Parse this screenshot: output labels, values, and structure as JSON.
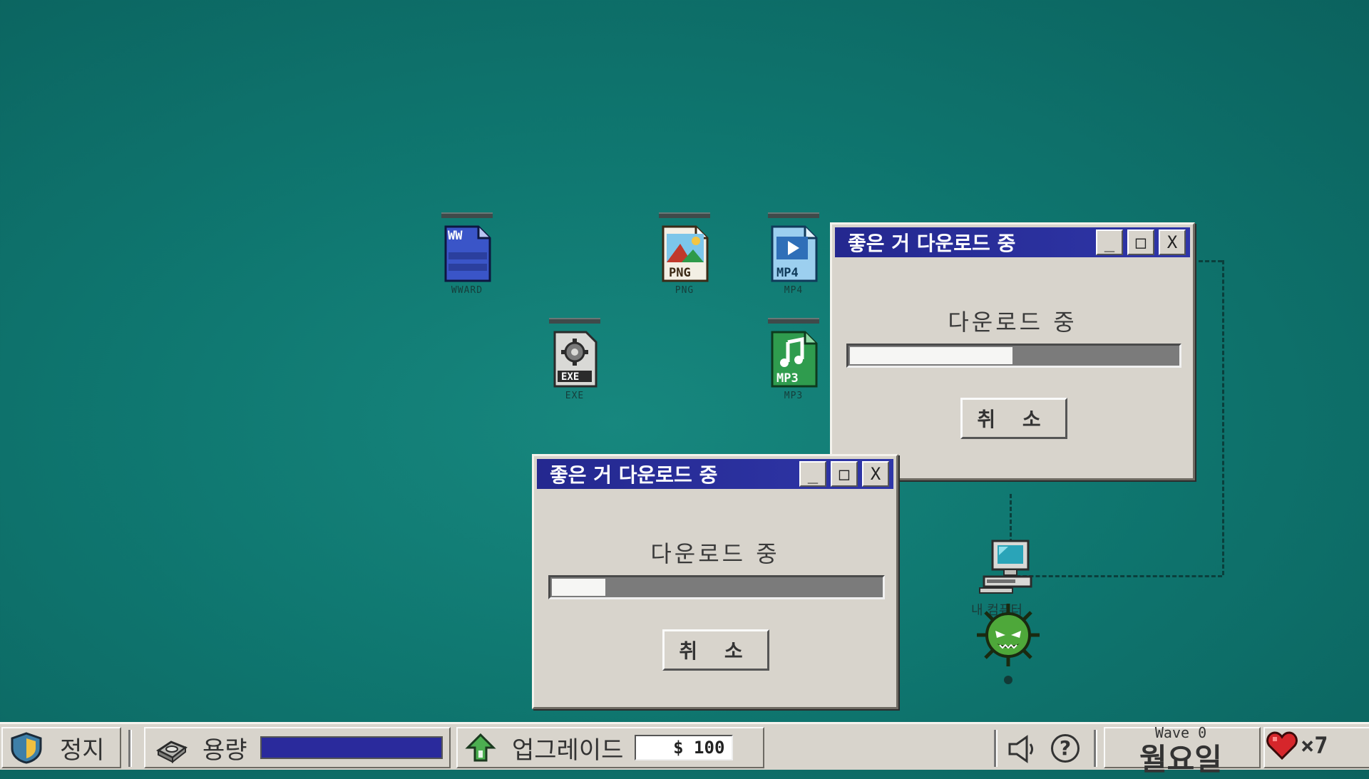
{
  "desktop": {
    "icons": [
      {
        "name": "WWARD",
        "type_text": "WW"
      },
      {
        "name": "PNG",
        "type_text": "PNG"
      },
      {
        "name": "MP4",
        "type_text": "MP4"
      },
      {
        "name": "EXE",
        "type_text": "EXE"
      },
      {
        "name": "MP3",
        "type_text": "MP3"
      }
    ],
    "pc_label": "내 컴퓨터"
  },
  "windows": [
    {
      "title": "좋은 거 다운로드 중",
      "message": "다운로드 중",
      "progress": 0.5,
      "cancel_label": "취 소"
    },
    {
      "title": "좋은 거 다운로드 중",
      "message": "다운로드 중",
      "progress": 0.17,
      "cancel_label": "취 소"
    }
  ],
  "window_controls": {
    "minimize": "_",
    "maximize": "□",
    "close": "X"
  },
  "taskbar": {
    "stop_label": "정지",
    "capacity_label": "용량",
    "capacity_level": 1.0,
    "upgrade_label": "업그레이드",
    "money": "$ 100",
    "help_label": "?",
    "wave": "Wave 0",
    "day": "월요일",
    "lives": "×7"
  },
  "colors": {
    "desktop": "#0f7770",
    "titlebar": "#24288f",
    "window": "#d8d4cc",
    "capacity_bar": "#2a2a9c"
  }
}
